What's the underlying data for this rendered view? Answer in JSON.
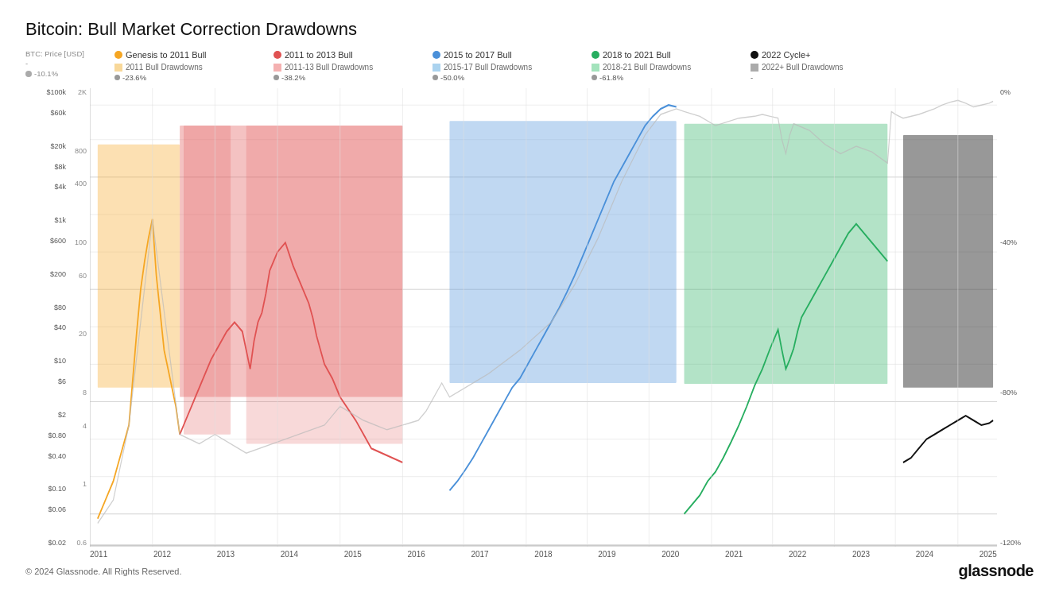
{
  "title": "Bitcoin: Bull Market Correction Drawdowns",
  "legend": {
    "row1": [
      {
        "type": "dot",
        "color": "#F5A623",
        "label": "Genesis to 2011 Bull"
      },
      {
        "type": "dot",
        "color": "#E05252",
        "label": "2011 to 2013 Bull"
      },
      {
        "type": "dot",
        "color": "#4A90D9",
        "label": "2015 to 2017 Bull"
      },
      {
        "type": "dot",
        "color": "#27AE60",
        "label": "2018 to 2021 Bull"
      },
      {
        "type": "dot",
        "color": "#111",
        "label": "2022 Cycle+"
      }
    ],
    "row2": [
      {
        "type": "rect",
        "color": "#F5A623",
        "label": "2011 Bull Drawdowns",
        "stat": "-23.6%"
      },
      {
        "type": "rect",
        "color": "#E87B7B",
        "label": "2011-13 Bull Drawdowns",
        "stat": "-38.2%"
      },
      {
        "type": "rect",
        "color": "#7BB8E8",
        "label": "2015-17 Bull Drawdowns",
        "stat": "-50.0%"
      },
      {
        "type": "rect",
        "color": "#6ECF8A",
        "label": "2018-21 Bull Drawdowns",
        "stat": "-61.8%"
      },
      {
        "type": "rect",
        "color": "#555",
        "label": "2022+ Bull Drawdowns",
        "stat": "-"
      }
    ]
  },
  "yaxis_left_price": [
    "$100k",
    "$60k",
    "",
    "$20k",
    "$8k",
    "$4k",
    "",
    "$1k",
    "$600",
    "",
    "$200",
    "",
    "$80",
    "$40",
    "",
    "$10",
    "$6",
    "",
    "$2",
    "$0.80",
    "$0.40",
    "",
    "$0.10",
    "$0.06",
    "",
    "$0.02"
  ],
  "yaxis_left_log": [
    "2K",
    "",
    "800",
    "400",
    "",
    "100",
    "60",
    "",
    "20",
    "",
    "8",
    "4",
    "",
    "1",
    "",
    "0.6"
  ],
  "yaxis_right": [
    "0%",
    "",
    "",
    "",
    "-40%",
    "",
    "",
    "",
    "-80%",
    "",
    "",
    "",
    "-120%"
  ],
  "xaxis_labels": [
    "2011",
    "2012",
    "2013",
    "2014",
    "2015",
    "2016",
    "2017",
    "2018",
    "2019",
    "2020",
    "2021",
    "2022",
    "2023",
    "2024",
    "2025"
  ],
  "btc_label": "BTC: Price [USD]",
  "btc_stat": "-10.1%",
  "footer_copyright": "© 2024 Glassnode. All Rights Reserved.",
  "footer_logo": "glassnode"
}
